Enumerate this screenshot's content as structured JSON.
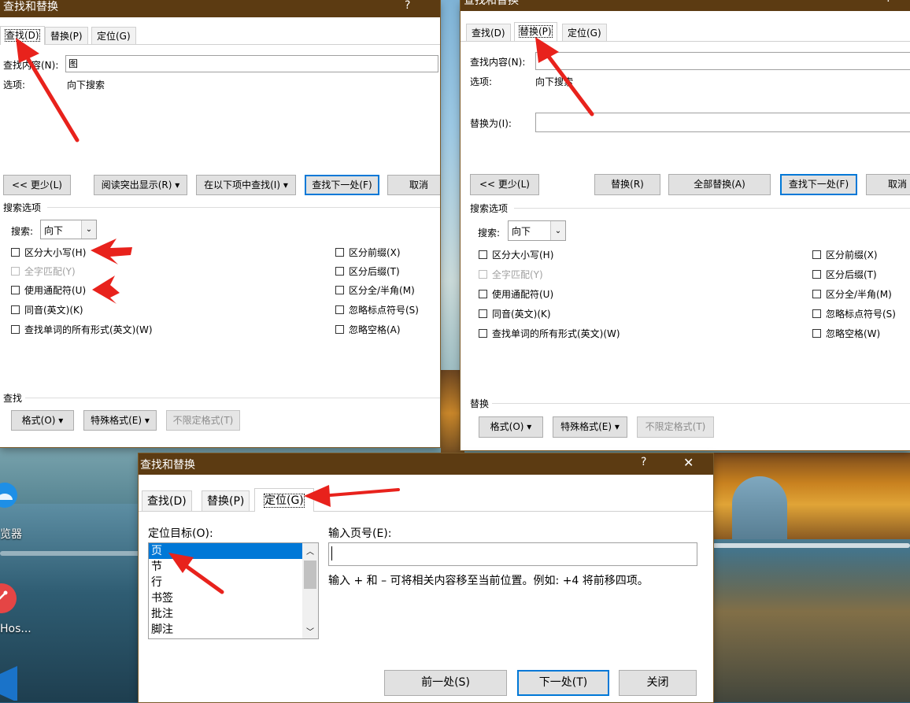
{
  "desktop": {
    "icon_labels": [
      "览器",
      "Hos..."
    ]
  },
  "dialog_find": {
    "title": "查找和替换",
    "help": "?",
    "tabs": [
      "查找(D)",
      "替换(P)",
      "定位(G)"
    ],
    "find_label": "查找内容(N):",
    "find_value": "图",
    "options_label": "选项:",
    "options_value": "向下搜索",
    "buttons": {
      "less": "<< 更少(L)",
      "reading_highlight": "阅读突出显示(R) ▾",
      "find_in": "在以下项中查找(I) ▾",
      "find_next": "查找下一处(F)",
      "cancel": "取消"
    },
    "search_options_title": "搜索选项",
    "search_label": "搜索:",
    "search_value": "向下",
    "checkboxes_left": [
      "区分大小写(H)",
      "全字匹配(Y)",
      "使用通配符(U)",
      "同音(英文)(K)",
      "查找单词的所有形式(英文)(W)"
    ],
    "checkboxes_right": [
      "区分前缀(X)",
      "区分后缀(T)",
      "区分全/半角(M)",
      "忽略标点符号(S)",
      "忽略空格(A)"
    ],
    "footer_title": "查找",
    "footer_buttons": [
      "格式(O) ▾",
      "特殊格式(E) ▾",
      "不限定格式(T)"
    ]
  },
  "dialog_replace": {
    "title": "查找和替换",
    "help": "?",
    "tabs": [
      "查找(D)",
      "替换(P)",
      "定位(G)"
    ],
    "find_label": "查找内容(N):",
    "options_label": "选项:",
    "options_value": "向下搜索",
    "replace_label": "替换为(I):",
    "buttons": {
      "less": "<< 更少(L)",
      "replace": "替换(R)",
      "replace_all": "全部替换(A)",
      "find_next": "查找下一处(F)",
      "cancel": "取消"
    },
    "search_options_title": "搜索选项",
    "search_label": "搜索:",
    "search_value": "向下",
    "checkboxes_left": [
      "区分大小写(H)",
      "全字匹配(Y)",
      "使用通配符(U)",
      "同音(英文)(K)",
      "查找单词的所有形式(英文)(W)"
    ],
    "checkboxes_right": [
      "区分前缀(X)",
      "区分后缀(T)",
      "区分全/半角(M)",
      "忽略标点符号(S)",
      "忽略空格(W)"
    ],
    "footer_title": "替换",
    "footer_buttons": [
      "格式(O) ▾",
      "特殊格式(E) ▾",
      "不限定格式(T)"
    ]
  },
  "dialog_goto": {
    "title": "查找和替换",
    "help": "?",
    "close": "✕",
    "tabs": [
      "查找(D)",
      "替换(P)",
      "定位(G)"
    ],
    "target_label": "定位目标(O):",
    "targets": [
      "页",
      "节",
      "行",
      "书签",
      "批注",
      "脚注"
    ],
    "selected_target": "页",
    "page_label": "输入页号(E):",
    "page_value": "",
    "hint": "输入 + 和 – 可将相关内容移至当前位置。例如: +4 将前移四项。",
    "buttons": {
      "prev": "前一处(S)",
      "next": "下一处(T)",
      "close": "关闭"
    }
  },
  "colors": {
    "titlebar": "#5c3b12",
    "accent": "#0078d7",
    "annotation_arrow": "#e8221c"
  }
}
